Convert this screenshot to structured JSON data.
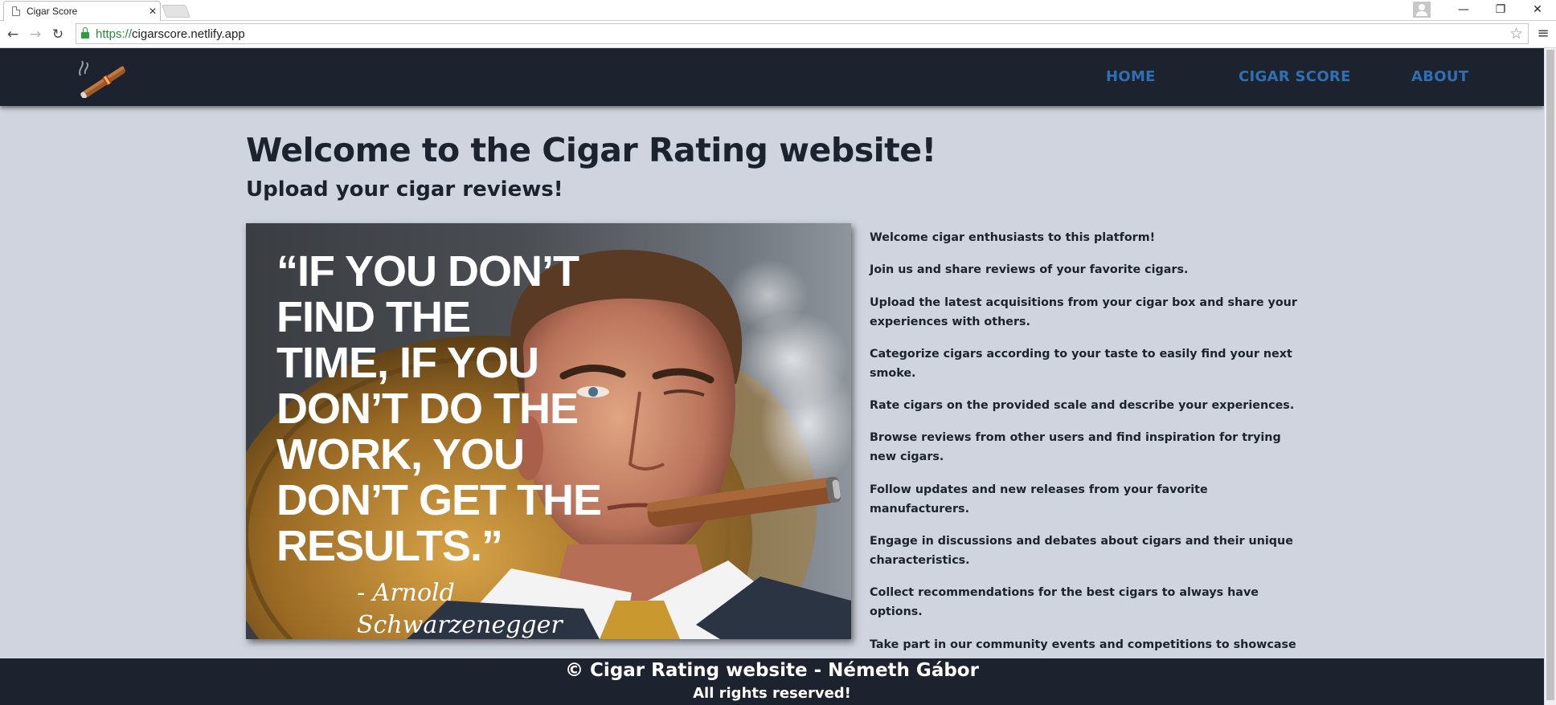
{
  "browser": {
    "tab_title": "Cigar Score",
    "tab_close": "✕",
    "url_scheme": "https://",
    "url_host": "cigarscore.netlify.app",
    "back": "←",
    "forward": "→",
    "reload": "↻",
    "star": "☆",
    "menu": "≡",
    "minimize": "—",
    "restore": "❐",
    "close": "✕"
  },
  "nav": {
    "home": "HOME",
    "cigar_score": "CIGAR SCORE",
    "about": "ABOUT"
  },
  "page": {
    "title": "Welcome to the Cigar Rating website!",
    "subtitle": "Upload your cigar reviews!"
  },
  "hero": {
    "quote_lines": [
      "“IF YOU DON’T",
      "FIND THE",
      "TIME, IF YOU",
      "DON’T DO THE",
      "WORK, YOU",
      "DON’T GET THE",
      "RESULTS.”"
    ],
    "author_line1": "- Arnold",
    "author_line2": "Schwarzenegger"
  },
  "description": [
    "Welcome cigar enthusiasts to this platform!",
    "Join us and share reviews of your favorite cigars.",
    "Upload the latest acquisitions from your cigar box and share your experiences with others.",
    "Categorize cigars according to your taste to easily find your next smoke.",
    "Rate cigars on the provided scale and describe your experiences.",
    "Browse reviews from other users and find inspiration for trying new cigars.",
    "Follow updates and new releases from your favorite manufacturers.",
    "Engage in discussions and debates about cigars and their unique characteristics.",
    "Collect recommendations for the best cigars to always have options.",
    "Take part in our community events and competitions to showcase your knowledge and taste."
  ],
  "footer": {
    "line1": "© Cigar Rating website - Németh Gábor",
    "line2": "All rights reserved!"
  },
  "colors": {
    "header_bg": "#1c232e",
    "page_bg": "#cfd4de",
    "nav_link": "#2f6fb3",
    "text": "#1c232e"
  }
}
